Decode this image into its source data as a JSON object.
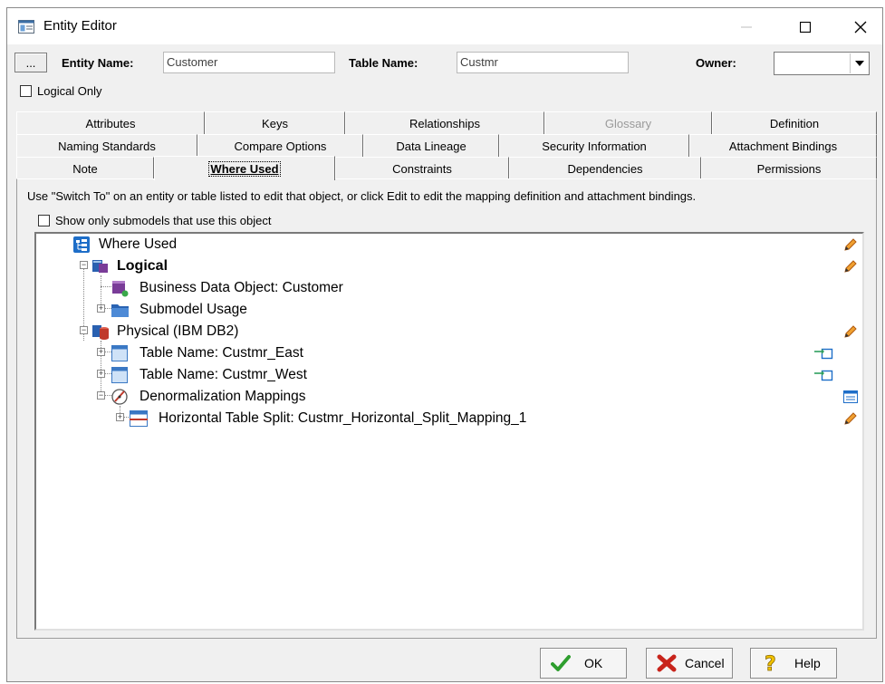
{
  "window": {
    "title": "Entity Editor"
  },
  "header": {
    "ellipsis_label": "...",
    "entity_name_label": "Entity Name:",
    "entity_name_value": "Customer",
    "table_name_label": "Table Name:",
    "table_name_value": "Custmr",
    "owner_label": "Owner:",
    "owner_value": "",
    "logical_only_label": "Logical Only"
  },
  "tabs": {
    "row1": [
      "Attributes",
      "Keys",
      "Relationships",
      "Glossary",
      "Definition"
    ],
    "row2": [
      "Naming Standards",
      "Compare Options",
      "Data Lineage",
      "Security Information",
      "Attachment Bindings"
    ],
    "row3": [
      "Note",
      "Where Used",
      "Constraints",
      "Dependencies",
      "Permissions"
    ],
    "active": "Where Used",
    "disabled": "Glossary"
  },
  "where_used": {
    "info": "Use \"Switch To\" on an entity or table listed to edit that object, or click Edit to edit the mapping definition and attachment bindings.",
    "submodels_checkbox_label": "Show only submodels that use this object",
    "tree": [
      {
        "label": "Where Used",
        "icon": "where-used-icon",
        "action": "edit-pencil-icon"
      },
      {
        "label": "Logical",
        "icon": "logical-model-icon",
        "action": "edit-pencil-icon"
      },
      {
        "label": "Business Data Object: Customer",
        "icon": "business-data-object-icon",
        "action": ""
      },
      {
        "label": "Submodel Usage",
        "icon": "folder-icon",
        "action": ""
      },
      {
        "label": "Physical (IBM DB2)",
        "icon": "physical-model-icon",
        "action": "edit-pencil-icon"
      },
      {
        "label": "Table Name: Custmr_East",
        "icon": "table-icon",
        "action": "switch-to-icon"
      },
      {
        "label": "Table Name: Custmr_West",
        "icon": "table-icon",
        "action": "switch-to-icon"
      },
      {
        "label": "Denormalization Mappings",
        "icon": "denormalization-icon",
        "action": "mapping-list-icon"
      },
      {
        "label": "Horizontal Table Split: Custmr_Horizontal_Split_Mapping_1",
        "icon": "table-split-icon",
        "action": "edit-pencil-icon"
      }
    ]
  },
  "footer": {
    "ok_label": "OK",
    "cancel_label": "Cancel",
    "help_label": "Help"
  },
  "colors": {
    "accent_blue": "#1e6ec8",
    "logical_purple": "#7a3c98",
    "physical_red": "#c0392b",
    "pencil_orange": "#d4701a",
    "ok_green": "#2e9e2e",
    "cancel_red": "#c8241b"
  }
}
